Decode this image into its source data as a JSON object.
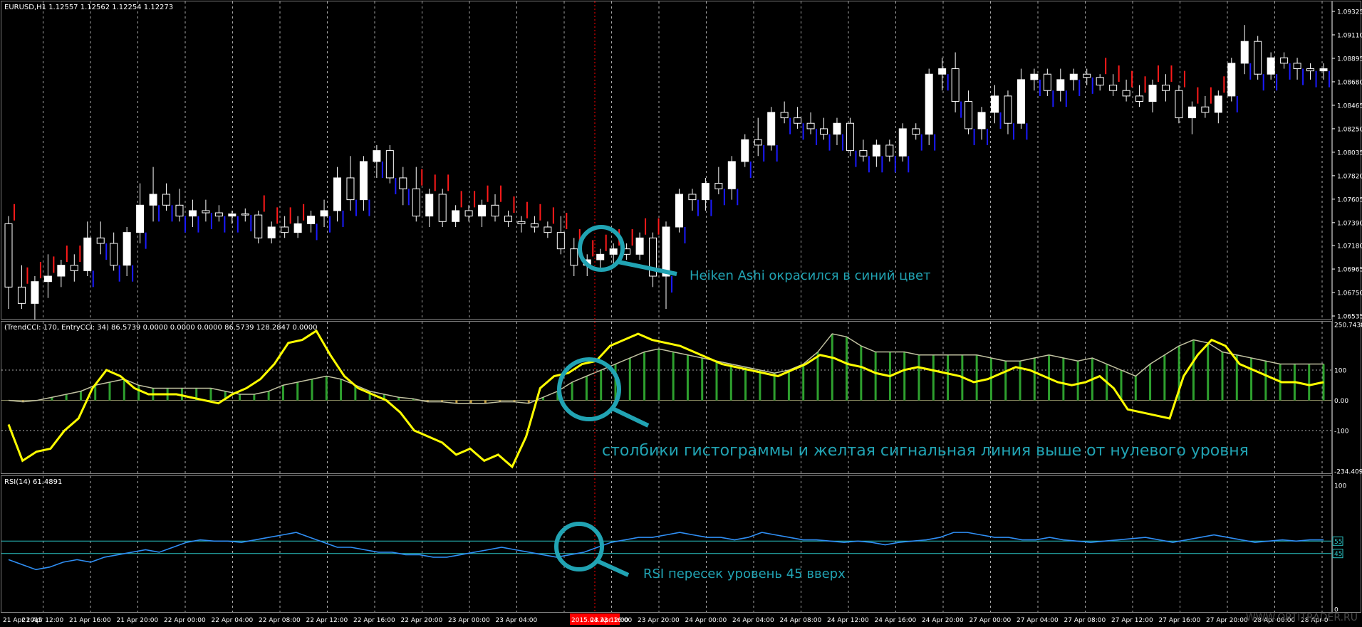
{
  "colors": {
    "background": "#000000",
    "frame": "#7f7f7f",
    "grid": "#a9a9a9",
    "text": "#ffffff",
    "ha_bull": "#1a1aff",
    "ha_bear": "#ff1a1a",
    "candle": "#ffffff",
    "hist_pos": "#2ea02e",
    "hist_neg": "#c8a040",
    "trend_line": "#c0c0a0",
    "signal": "#ffff00",
    "rsi": "#2f8ff5",
    "rsi_level": "#2bc4c4",
    "annotation": "#21a3b3",
    "marker": "#ff0000"
  },
  "main": {
    "header": "EURUSD,H1  1.12557 1.12562 1.12254 1.12273",
    "price_labels": [
      "1.09325",
      "1.09110",
      "1.08895",
      "1.08680",
      "1.08465",
      "1.08250",
      "1.08035",
      "1.07820",
      "1.07605",
      "1.07390",
      "1.07180",
      "1.06965",
      "1.06750",
      "1.06535"
    ]
  },
  "cci": {
    "header": "(TrendCCI: 170, EntryCCI: 34)  86.5739 0.0000 0.0000 0.0000 86.5739 128.2847 0.0000",
    "labels": [
      "250.7438",
      "100",
      "0.00",
      "-100",
      "-234.4096"
    ]
  },
  "rsi": {
    "header": "RSI(14) 61.4891",
    "labels": [
      "100",
      "55",
      "45",
      "0"
    ]
  },
  "time_labels": [
    "21 Apr 2015",
    "21 Apr 12:00",
    "21 Apr 16:00",
    "21 Apr 20:00",
    "22 Apr 00:00",
    "22 Apr 04:00",
    "22 Apr 08:00",
    "22 Apr 12:00",
    "22 Apr 16:00",
    "22 Apr 20:00",
    "23 Apr 00:00",
    "23 Apr 04:00",
    "2015.04.23 12:00",
    "23 Apr 16:00",
    "23 Apr 20:00",
    "24 Apr 00:00",
    "24 Apr 04:00",
    "24 Apr 08:00",
    "24 Apr 12:00",
    "24 Apr 16:00",
    "24 Apr 20:00",
    "27 Apr 00:00",
    "27 Apr 04:00",
    "27 Apr 08:00",
    "27 Apr 12:00",
    "27 Apr 16:00",
    "27 Apr 20:00",
    "28 Apr 00:00",
    "28 Apr 0"
  ],
  "annotations": {
    "heiken": "Heiken Ashi окрасился в синий цвет",
    "histogram": "столбики гистограммы и желтая сигнальная линия выше от нулевого уровня",
    "rsi": "RSI пересек уровень 45 вверх"
  },
  "watermark": "WWW.OPTITRADER.RU",
  "chart_data": [
    {
      "type": "candlestick",
      "title": "EURUSD,H1",
      "ylim": [
        1.06535,
        1.09325
      ],
      "candles_ohlc": [
        [
          1.0738,
          1.0745,
          1.066,
          1.068
        ],
        [
          1.068,
          1.07,
          1.066,
          1.0665
        ],
        [
          1.0665,
          1.069,
          1.065,
          1.0685
        ],
        [
          1.0685,
          1.071,
          1.067,
          1.069
        ],
        [
          1.069,
          1.0705,
          1.068,
          1.07
        ],
        [
          1.07,
          1.071,
          1.0685,
          1.0695
        ],
        [
          1.0695,
          1.074,
          1.069,
          1.0725
        ],
        [
          1.0725,
          1.074,
          1.071,
          1.072
        ],
        [
          1.072,
          1.073,
          1.0695,
          1.07
        ],
        [
          1.07,
          1.0735,
          1.069,
          1.073
        ],
        [
          1.073,
          1.0775,
          1.072,
          1.0755
        ],
        [
          1.0755,
          1.079,
          1.074,
          1.0765
        ],
        [
          1.0765,
          1.0775,
          1.075,
          1.0755
        ],
        [
          1.0755,
          1.077,
          1.074,
          1.0745
        ],
        [
          1.0745,
          1.076,
          1.0735,
          1.075
        ],
        [
          1.075,
          1.076,
          1.074,
          1.0748
        ],
        [
          1.0748,
          1.0755,
          1.074,
          1.0745
        ],
        [
          1.0745,
          1.075,
          1.0738,
          1.0747
        ],
        [
          1.0747,
          1.0752,
          1.074,
          1.0746
        ],
        [
          1.0746,
          1.075,
          1.072,
          1.0725
        ],
        [
          1.0725,
          1.074,
          1.072,
          1.0735
        ],
        [
          1.0735,
          1.0745,
          1.0725,
          1.073
        ],
        [
          1.073,
          1.0745,
          1.0725,
          1.0738
        ],
        [
          1.0738,
          1.075,
          1.073,
          1.0745
        ],
        [
          1.0745,
          1.076,
          1.0735,
          1.075
        ],
        [
          1.075,
          1.079,
          1.074,
          1.078
        ],
        [
          1.078,
          1.08,
          1.075,
          1.076
        ],
        [
          1.076,
          1.08,
          1.075,
          1.0795
        ],
        [
          1.0795,
          1.081,
          1.078,
          1.0805
        ],
        [
          1.0805,
          1.081,
          1.0775,
          1.078
        ],
        [
          1.078,
          1.079,
          1.0755,
          1.077
        ],
        [
          1.077,
          1.079,
          1.074,
          1.0745
        ],
        [
          1.0745,
          1.077,
          1.0735,
          1.0765
        ],
        [
          1.0765,
          1.077,
          1.0735,
          1.074
        ],
        [
          1.074,
          1.0755,
          1.0735,
          1.075
        ],
        [
          1.075,
          1.0755,
          1.074,
          1.0745
        ],
        [
          1.0745,
          1.076,
          1.0735,
          1.0755
        ],
        [
          1.0755,
          1.0765,
          1.074,
          1.0745
        ],
        [
          1.0745,
          1.075,
          1.0735,
          1.074
        ],
        [
          1.074,
          1.0745,
          1.073,
          1.0738
        ],
        [
          1.0738,
          1.0745,
          1.073,
          1.0735
        ],
        [
          1.0735,
          1.074,
          1.0725,
          1.073
        ],
        [
          1.073,
          1.0745,
          1.071,
          1.0715
        ],
        [
          1.0715,
          1.0725,
          1.069,
          1.07
        ],
        [
          1.07,
          1.071,
          1.069,
          1.0705
        ],
        [
          1.0705,
          1.0715,
          1.0695,
          1.071
        ],
        [
          1.071,
          1.072,
          1.07,
          1.0715
        ],
        [
          1.0715,
          1.072,
          1.0705,
          1.071
        ],
        [
          1.071,
          1.073,
          1.0705,
          1.0725
        ],
        [
          1.0725,
          1.073,
          1.068,
          1.069
        ],
        [
          1.069,
          1.074,
          1.066,
          1.0735
        ],
        [
          1.0735,
          1.077,
          1.073,
          1.0765
        ],
        [
          1.0765,
          1.077,
          1.075,
          1.076
        ],
        [
          1.076,
          1.078,
          1.075,
          1.0775
        ],
        [
          1.0775,
          1.079,
          1.0765,
          1.077
        ],
        [
          1.077,
          1.08,
          1.076,
          1.0795
        ],
        [
          1.0795,
          1.082,
          1.079,
          1.0815
        ],
        [
          1.0815,
          1.0835,
          1.08,
          1.081
        ],
        [
          1.081,
          1.0845,
          1.0805,
          1.084
        ],
        [
          1.084,
          1.085,
          1.083,
          1.0835
        ],
        [
          1.0835,
          1.0845,
          1.0825,
          1.083
        ],
        [
          1.083,
          1.084,
          1.082,
          1.0825
        ],
        [
          1.0825,
          1.0835,
          1.0815,
          1.082
        ],
        [
          1.082,
          1.0835,
          1.081,
          1.083
        ],
        [
          1.083,
          1.0835,
          1.08,
          1.0805
        ],
        [
          1.0805,
          1.0815,
          1.0795,
          1.08
        ],
        [
          1.08,
          1.0815,
          1.079,
          1.081
        ],
        [
          1.081,
          1.0815,
          1.0795,
          1.08
        ],
        [
          1.08,
          1.083,
          1.0795,
          1.0825
        ],
        [
          1.0825,
          1.083,
          1.0815,
          1.082
        ],
        [
          1.082,
          1.088,
          1.081,
          1.0875
        ],
        [
          1.0875,
          1.089,
          1.086,
          1.088
        ],
        [
          1.088,
          1.0895,
          1.084,
          1.085
        ],
        [
          1.085,
          1.086,
          1.082,
          1.0825
        ],
        [
          1.0825,
          1.0845,
          1.0815,
          1.084
        ],
        [
          1.084,
          1.0865,
          1.083,
          1.0855
        ],
        [
          1.0855,
          1.086,
          1.082,
          1.083
        ],
        [
          1.083,
          1.088,
          1.0825,
          1.087
        ],
        [
          1.087,
          1.088,
          1.086,
          1.0875
        ],
        [
          1.0875,
          1.088,
          1.0855,
          1.086
        ],
        [
          1.086,
          1.088,
          1.085,
          1.087
        ],
        [
          1.087,
          1.088,
          1.086,
          1.0875
        ],
        [
          1.0875,
          1.088,
          1.0865,
          1.0872
        ],
        [
          1.0872,
          1.0875,
          1.086,
          1.0865
        ],
        [
          1.0865,
          1.0875,
          1.0855,
          1.086
        ],
        [
          1.086,
          1.087,
          1.085,
          1.0855
        ],
        [
          1.0855,
          1.0865,
          1.0845,
          1.085
        ],
        [
          1.085,
          1.087,
          1.084,
          1.0865
        ],
        [
          1.0865,
          1.0875,
          1.085,
          1.086
        ],
        [
          1.086,
          1.0865,
          1.083,
          1.0835
        ],
        [
          1.0835,
          1.085,
          1.082,
          1.0845
        ],
        [
          1.0845,
          1.0855,
          1.0835,
          1.084
        ],
        [
          1.084,
          1.086,
          1.083,
          1.0855
        ],
        [
          1.0855,
          1.089,
          1.085,
          1.0885
        ],
        [
          1.0885,
          1.092,
          1.0875,
          1.0905
        ],
        [
          1.0905,
          1.091,
          1.087,
          1.0875
        ],
        [
          1.0875,
          1.0895,
          1.087,
          1.089
        ],
        [
          1.089,
          1.0895,
          1.088,
          1.0885
        ],
        [
          1.0885,
          1.089,
          1.087,
          1.088
        ],
        [
          1.088,
          1.0885,
          1.087,
          1.0878
        ],
        [
          1.0878,
          1.0885,
          1.087,
          1.088
        ]
      ],
      "heiken_ashi_color": [
        "bear",
        "bear",
        "bear",
        "bear",
        "bear",
        "bear",
        "bull",
        "bull",
        "bull",
        "bull",
        "bull",
        "bull",
        "bull",
        "bull",
        "bull",
        "bull",
        "bull",
        "bull",
        "bull",
        "bear",
        "bear",
        "bear",
        "bear",
        "bull",
        "bull",
        "bull",
        "bull",
        "bull",
        "bull",
        "bull",
        "bull",
        "bear",
        "bear",
        "bear",
        "bear",
        "bear",
        "bear",
        "bear",
        "bear",
        "bear",
        "bear",
        "bear",
        "bear",
        "bear",
        "bear",
        "bear",
        "bear",
        "bear",
        "bear",
        "bear",
        "bull",
        "bull",
        "bull",
        "bull",
        "bull",
        "bull",
        "bull",
        "bull",
        "bull",
        "bull",
        "bull",
        "bull",
        "bull",
        "bull",
        "bull",
        "bull",
        "bull",
        "bull",
        "bull",
        "bull",
        "bull",
        "bull",
        "bull",
        "bull",
        "bull",
        "bull",
        "bull",
        "bull",
        "bull",
        "bull",
        "bull",
        "bull",
        "bull",
        "bear",
        "bear",
        "bear",
        "bear",
        "bear",
        "bear",
        "bear",
        "bear",
        "bear",
        "bear",
        "bull",
        "bull",
        "bull",
        "bull",
        "bull",
        "bull",
        "bull",
        "bull"
      ]
    },
    {
      "type": "bar",
      "title": "TrendCCI 170 / EntryCCI 34",
      "ylim": [
        -234.4096,
        250.7438
      ],
      "trend_cci": [
        0,
        -5,
        0,
        10,
        20,
        30,
        50,
        60,
        70,
        50,
        40,
        40,
        40,
        40,
        40,
        30,
        20,
        20,
        30,
        50,
        60,
        70,
        80,
        70,
        50,
        30,
        20,
        10,
        5,
        -5,
        -5,
        -10,
        -10,
        -10,
        -5,
        -5,
        -10,
        10,
        30,
        60,
        80,
        100,
        120,
        140,
        160,
        170,
        160,
        150,
        140,
        130,
        120,
        110,
        100,
        90,
        100,
        120,
        160,
        220,
        210,
        180,
        160,
        160,
        160,
        150,
        150,
        150,
        150,
        150,
        140,
        130,
        130,
        140,
        150,
        140,
        130,
        140,
        120,
        100,
        80,
        120,
        150,
        180,
        200,
        190,
        160,
        150,
        140,
        130,
        120,
        120,
        120,
        120
      ],
      "entry_cci": [
        -80,
        -200,
        -170,
        -160,
        -100,
        -60,
        40,
        100,
        80,
        40,
        20,
        20,
        20,
        10,
        0,
        -10,
        20,
        40,
        70,
        120,
        190,
        200,
        230,
        150,
        80,
        40,
        20,
        0,
        -40,
        -100,
        -120,
        -140,
        -180,
        -160,
        -200,
        -180,
        -220,
        -120,
        40,
        80,
        90,
        120,
        130,
        180,
        200,
        220,
        200,
        190,
        180,
        160,
        140,
        120,
        110,
        100,
        90,
        80,
        100,
        120,
        150,
        140,
        120,
        110,
        90,
        80,
        100,
        110,
        100,
        90,
        80,
        60,
        70,
        90,
        110,
        100,
        80,
        60,
        50,
        60,
        80,
        40,
        -30,
        -40,
        -50,
        -60,
        80,
        150,
        200,
        180,
        120,
        100,
        80,
        60,
        60,
        50,
        60
      ]
    },
    {
      "type": "line",
      "title": "RSI(14)",
      "ylim": [
        0,
        100
      ],
      "levels": [
        45,
        55
      ],
      "values": [
        40,
        36,
        32,
        34,
        38,
        40,
        38,
        42,
        44,
        46,
        48,
        46,
        50,
        54,
        56,
        55,
        55,
        54,
        56,
        58,
        60,
        62,
        58,
        54,
        50,
        50,
        48,
        46,
        46,
        44,
        44,
        42,
        42,
        44,
        46,
        48,
        50,
        48,
        46,
        44,
        42,
        44,
        46,
        50,
        54,
        56,
        58,
        58,
        60,
        62,
        60,
        58,
        58,
        56,
        58,
        62,
        60,
        58,
        56,
        56,
        55,
        54,
        55,
        54,
        52,
        54,
        55,
        56,
        58,
        62,
        62,
        60,
        58,
        58,
        56,
        56,
        58,
        56,
        55,
        54,
        55,
        56,
        57,
        58,
        56,
        54,
        56,
        58,
        60,
        58,
        56,
        54,
        55,
        56,
        55,
        56,
        56
      ]
    }
  ]
}
